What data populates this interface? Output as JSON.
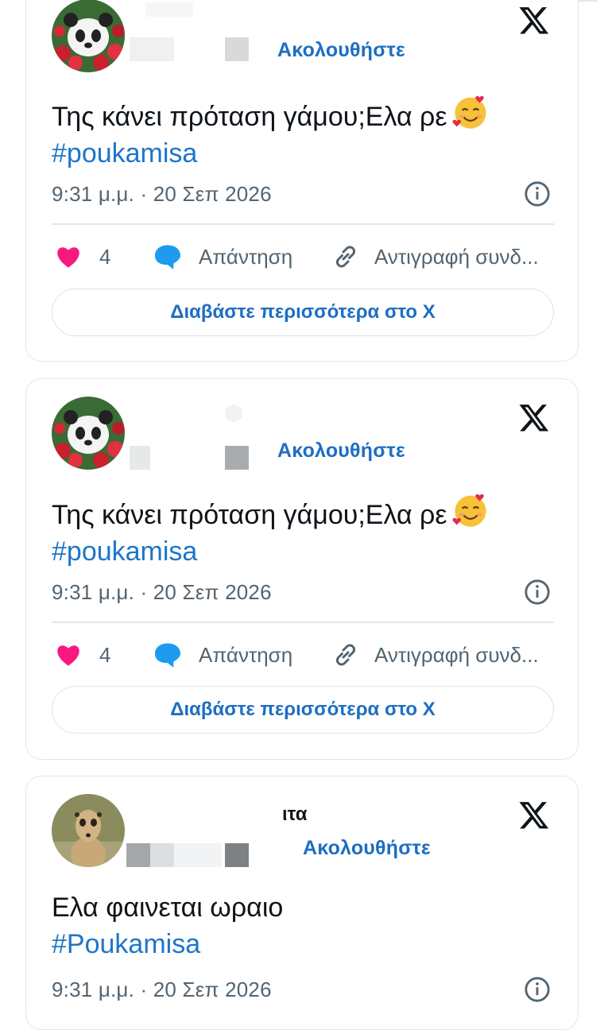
{
  "cards": [
    {
      "follow_label": "Ακολουθήστε",
      "name_fragment": "",
      "text": "Της κάνει πρόταση γάμου;Ελα ρε",
      "hashtag": "#poukamisa",
      "timestamp": "9:31 μ.μ. · 20 Σεπ 2026",
      "likes": "4",
      "reply_label": "Απάντηση",
      "copy_label": "Αντιγραφή συνδ...",
      "read_more": "Διαβάστε περισσότερα στο Χ",
      "avatar": "panda-avatar"
    },
    {
      "follow_label": "Ακολουθήστε",
      "name_fragment": "",
      "text": "Της κάνει πρόταση γάμου;Ελα ρε",
      "hashtag": "#poukamisa",
      "timestamp": "9:31 μ.μ. · 20 Σεπ 2026",
      "likes": "4",
      "reply_label": "Απάντηση",
      "copy_label": "Αντιγραφή συνδ...",
      "read_more": "Διαβάστε περισσότερα στο Χ",
      "avatar": "panda-avatar"
    },
    {
      "follow_label": "Ακολουθήστε",
      "name_fragment": "ιτα",
      "text": "Ελα φαινεται ωραιο",
      "hashtag": "#Poukamisa",
      "timestamp": "9:31 μ.μ. · 20 Σεπ 2026",
      "avatar": "meerkat-avatar"
    }
  ],
  "colors": {
    "link_blue": "#1d6ec1",
    "heart_pink": "#f91880",
    "reply_blue": "#1d9bf0",
    "muted": "#536471"
  }
}
